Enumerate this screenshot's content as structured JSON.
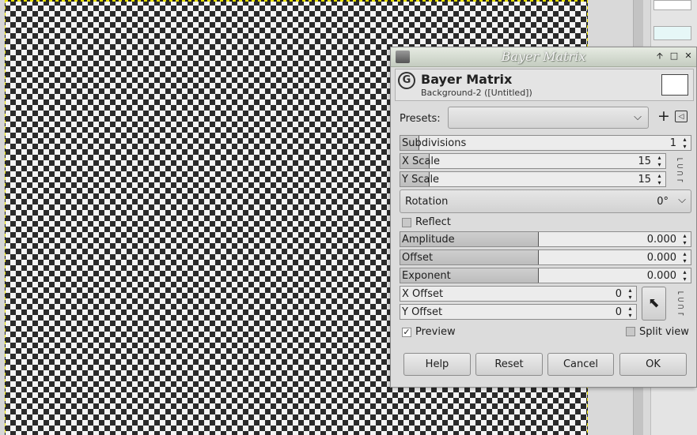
{
  "dialog": {
    "window_title": "Bayer Matrix",
    "procedure_title": "Bayer Matrix",
    "procedure_subtitle": "Background-2 ([Untitled])",
    "presets_label": "Presets:",
    "presets_value": "",
    "controls": {
      "subdivisions": {
        "label": "Subdivisions",
        "value": "1"
      },
      "x_scale": {
        "label": "X Scale",
        "value": "15"
      },
      "y_scale": {
        "label": "Y Scale",
        "value": "15"
      },
      "rotation": {
        "label": "Rotation",
        "value": "0°"
      },
      "reflect": {
        "label": "Reflect",
        "checked": false
      },
      "amplitude": {
        "label": "Amplitude",
        "value": "0.000"
      },
      "offset": {
        "label": "Offset",
        "value": "0.000"
      },
      "exponent": {
        "label": "Exponent",
        "value": "0.000"
      },
      "x_offset": {
        "label": "X Offset",
        "value": "0"
      },
      "y_offset": {
        "label": "Y Offset",
        "value": "0"
      }
    },
    "preview": {
      "label": "Preview",
      "checked": true
    },
    "split_view": {
      "label": "Split view",
      "checked": false
    },
    "buttons": {
      "help": "Help",
      "reset": "Reset",
      "cancel": "Cancel",
      "ok": "OK"
    }
  },
  "icons": {
    "window_menu": "window-menu-icon",
    "plugin_logo": "gimp-logo-icon",
    "add_preset": "plus-icon",
    "preset_menu": "triangle-left-icon",
    "chain": "chain-link-icon",
    "pick": "pointer-icon"
  },
  "glyphs": {
    "logo": "G",
    "dropdown": "⌵",
    "plus": "+",
    "menu": "◁",
    "spin": "▴▾",
    "check": "✓",
    "pick": "⬉",
    "chain": "⌐⊂⊃¬",
    "wm_up": "🡩",
    "wm_max": "□",
    "wm_close": "✕"
  }
}
